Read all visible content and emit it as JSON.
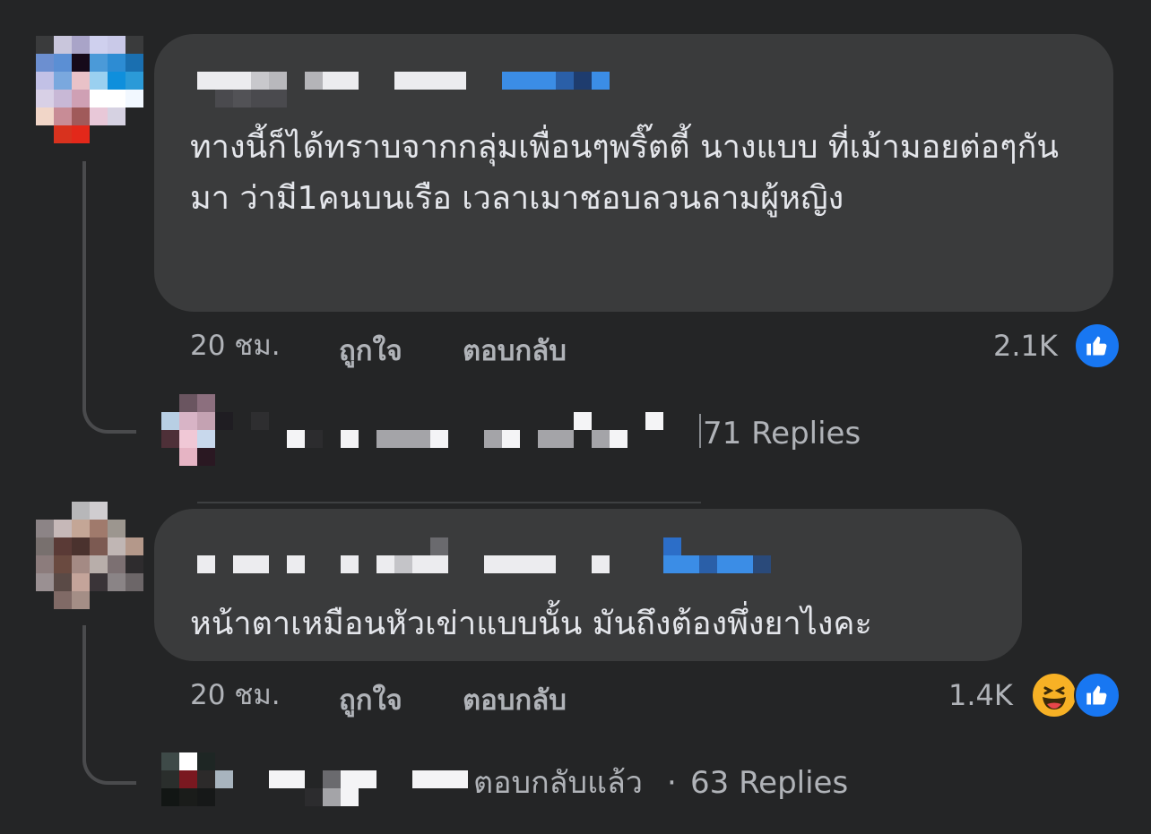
{
  "comments": [
    {
      "text": "ทางนี้ก็ได้ทราบจากกลุ่มเพื่อนๆพริ๊ตตี้ นางแบบ ที่เม้ามอยต่อๆกันมา ว่ามี1คนบนเรือ เวลาเมาชอบลวนลามผู้หญิง",
      "time": "20 ชม.",
      "like_label": "ถูกใจ",
      "reply_label": "ตอบกลับ",
      "reaction_count": "2.1K",
      "reactions": [
        "like-icon"
      ],
      "replies_text": "71 Replies"
    },
    {
      "text": "หน้าตาเหมือนหัวเข่าแบบนั้น มันถึงต้องพึ่งยาไงคะ",
      "time": "20 ชม.",
      "like_label": "ถูกใจ",
      "reply_label": "ตอบกลับ",
      "reaction_count": "1.4K",
      "reactions": [
        "haha-icon",
        "like-icon"
      ],
      "replied_label": "ตอบกลับแล้ว",
      "separator": "·",
      "replies_text": "63 Replies"
    }
  ],
  "colors": {
    "background": "#242526",
    "bubble": "#3a3b3c",
    "secondary_text": "#b0b3b8",
    "like_blue": "#1877f2",
    "haha_yellow": "#f7b125"
  }
}
